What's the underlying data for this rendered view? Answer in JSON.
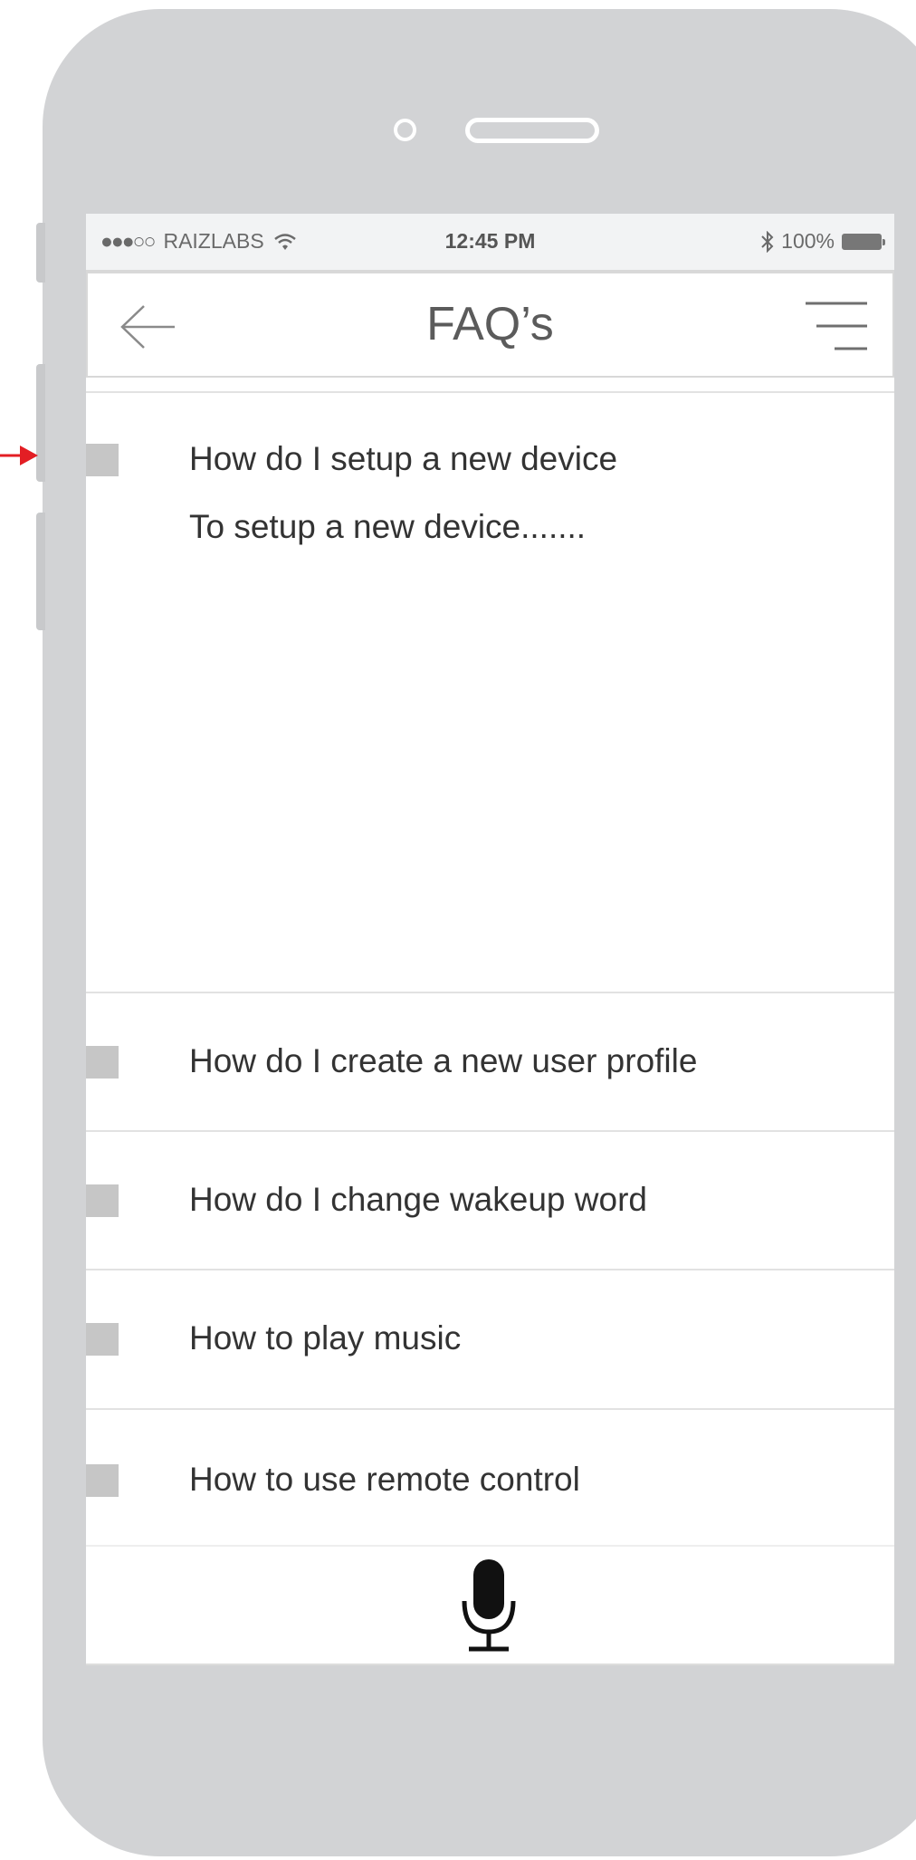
{
  "status_bar": {
    "signal": "●●●○○",
    "carrier": "RAIZLABS",
    "time": "12:45 PM",
    "battery": "100%",
    "icons": [
      "wifi-icon",
      "bluetooth-icon",
      "battery-icon"
    ]
  },
  "nav": {
    "title": "FAQ’s",
    "icons": [
      "back-arrow-icon",
      "menu-icon"
    ]
  },
  "faq": [
    {
      "question": "How do I setup a new device",
      "answer": "To setup a new device.......",
      "expanded": true
    },
    {
      "question": "How do I create a new user profile",
      "expanded": false
    },
    {
      "question": "How do I change wakeup word",
      "expanded": false
    },
    {
      "question": "How to play music",
      "expanded": false
    },
    {
      "question": "How to use remote control",
      "expanded": false
    }
  ],
  "footer": {
    "icon": "microphone-icon"
  },
  "colors": {
    "device_frame": "#d2d3d5",
    "marker_arrow": "#e31e24",
    "text": "#333333",
    "title": "#5b5b5b",
    "bullet": "#c6c6c6"
  }
}
